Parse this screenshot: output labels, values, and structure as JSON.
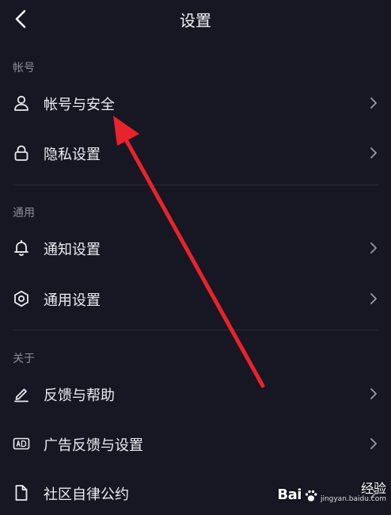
{
  "header": {
    "title": "设置"
  },
  "sections": [
    {
      "title": "帐号",
      "items": [
        {
          "label": "帐号与安全",
          "icon": "user-icon"
        },
        {
          "label": "隐私设置",
          "icon": "lock-icon"
        }
      ]
    },
    {
      "title": "通用",
      "items": [
        {
          "label": "通知设置",
          "icon": "bell-icon"
        },
        {
          "label": "通用设置",
          "icon": "gear-icon"
        }
      ]
    },
    {
      "title": "关于",
      "items": [
        {
          "label": "反馈与帮助",
          "icon": "pencil-icon"
        },
        {
          "label": "广告反馈与设置",
          "icon": "ad-icon"
        },
        {
          "label": "社区自律公约",
          "icon": "document-icon"
        }
      ]
    }
  ],
  "annotation": {
    "color": "#e8232c"
  },
  "watermark": {
    "logo": "Bai",
    "name": "经验",
    "url": "jingyan.baidu.com"
  }
}
